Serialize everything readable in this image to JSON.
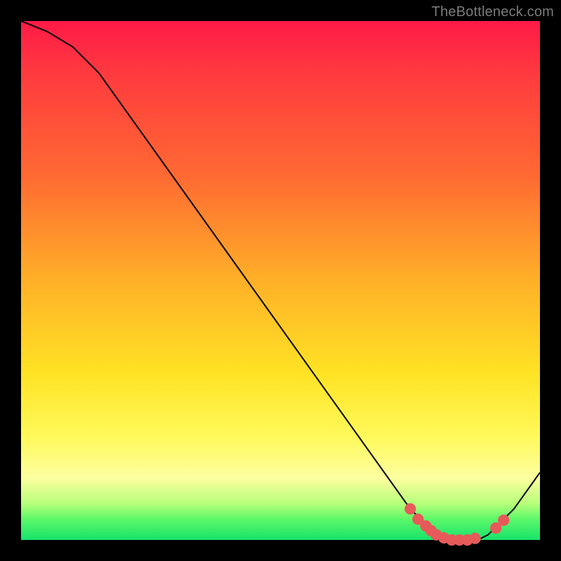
{
  "watermark": {
    "text": "TheBottleneck.com"
  },
  "chart_data": {
    "type": "line",
    "title": "",
    "xlabel": "",
    "ylabel": "",
    "xlim": [
      0,
      100
    ],
    "ylim": [
      0,
      100
    ],
    "grid": false,
    "legend": false,
    "series": [
      {
        "name": "curve",
        "color": "#000000",
        "x": [
          0,
          5,
          10,
          15,
          20,
          25,
          30,
          35,
          40,
          45,
          50,
          55,
          60,
          65,
          70,
          75,
          78,
          80,
          82,
          85,
          88,
          90,
          92,
          95,
          100
        ],
        "y": [
          100,
          98,
          95,
          90,
          83,
          76,
          69,
          62,
          55,
          48,
          41,
          34,
          27,
          20,
          13,
          6,
          3,
          1,
          0,
          0,
          0,
          1,
          3,
          6,
          13
        ]
      }
    ],
    "markers": [
      {
        "x": 75.0,
        "y": 6.0,
        "color": "#e65a5a"
      },
      {
        "x": 76.5,
        "y": 4.0,
        "color": "#e65a5a"
      },
      {
        "x": 78.0,
        "y": 2.7,
        "color": "#e65a5a"
      },
      {
        "x": 79.0,
        "y": 1.8,
        "color": "#e65a5a"
      },
      {
        "x": 80.0,
        "y": 1.0,
        "color": "#e65a5a"
      },
      {
        "x": 81.5,
        "y": 0.4,
        "color": "#e65a5a"
      },
      {
        "x": 83.0,
        "y": 0.0,
        "color": "#e65a5a"
      },
      {
        "x": 84.5,
        "y": 0.0,
        "color": "#e65a5a"
      },
      {
        "x": 86.0,
        "y": 0.0,
        "color": "#e65a5a"
      },
      {
        "x": 87.5,
        "y": 0.3,
        "color": "#e65a5a"
      },
      {
        "x": 91.5,
        "y": 2.3,
        "color": "#e65a5a"
      },
      {
        "x": 93.0,
        "y": 3.8,
        "color": "#e65a5a"
      }
    ],
    "background_gradient": {
      "direction": "vertical",
      "stops": [
        {
          "pos": 0.0,
          "color": "#ff1a47"
        },
        {
          "pos": 0.5,
          "color": "#ffb028"
        },
        {
          "pos": 0.8,
          "color": "#fff95a"
        },
        {
          "pos": 1.0,
          "color": "#16e36a"
        }
      ]
    }
  }
}
